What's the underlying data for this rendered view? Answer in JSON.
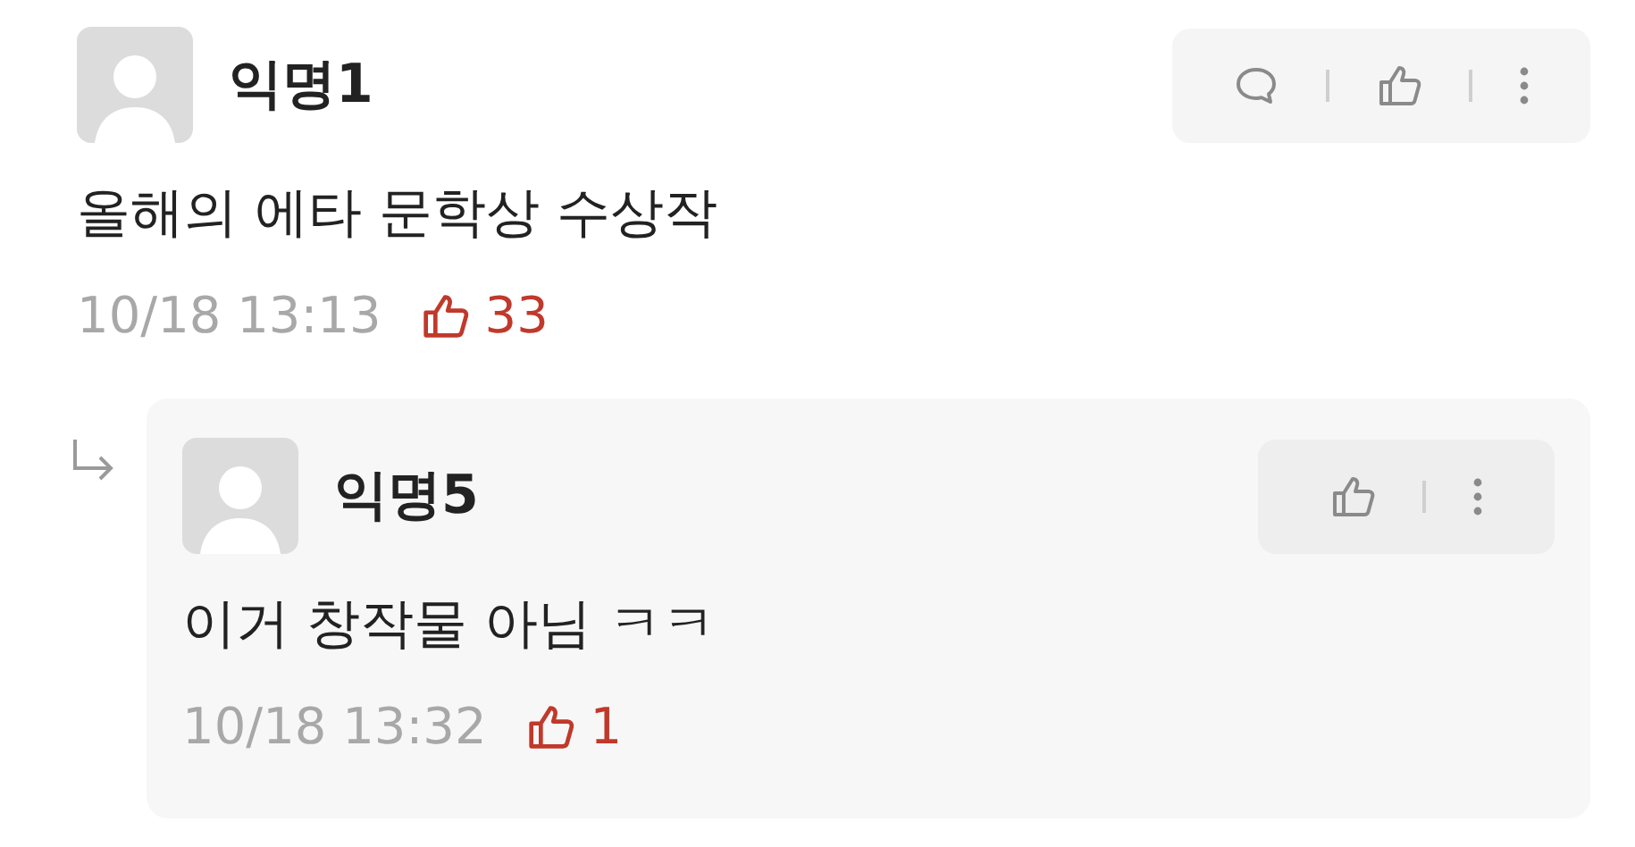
{
  "comments": [
    {
      "author": "익명1",
      "body": "올해의 에타 문학상 수상작",
      "time": "10/18 13:13",
      "likes": "33",
      "actions": [
        {
          "kind": "reply"
        },
        {
          "kind": "like"
        },
        {
          "kind": "more"
        }
      ],
      "children": [
        {
          "author": "익명5",
          "body": "이거 창작물 아님 ㅋㅋ",
          "time": "10/18 13:32",
          "likes": "1",
          "actions": [
            {
              "kind": "like"
            },
            {
              "kind": "more"
            }
          ]
        }
      ]
    }
  ]
}
